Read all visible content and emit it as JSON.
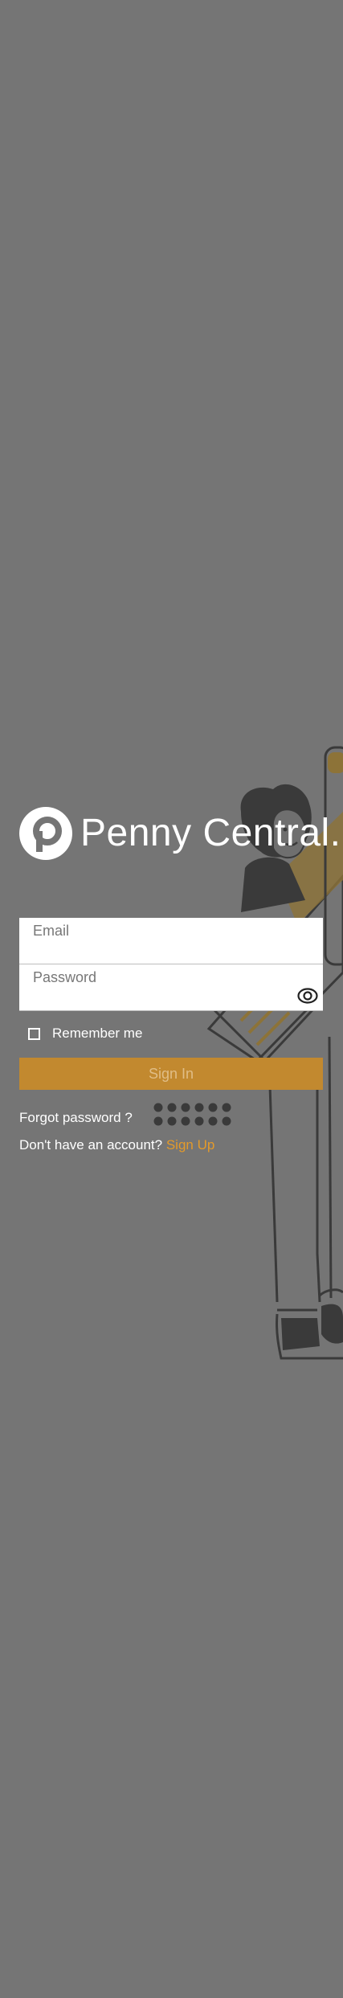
{
  "app": {
    "logo_text": "Penny Central.",
    "logo_icon": "penny-p-logo-icon"
  },
  "form": {
    "email_label": "Email",
    "email_value": "",
    "password_label": "Password",
    "password_value": "",
    "password_toggle_icon": "eye-icon",
    "remember_label": "Remember me",
    "remember_checked": false,
    "signin_label": "Sign In",
    "forgot_label": "Forgot password ?",
    "signup_prompt": "Don't have an account?",
    "signup_link": "Sign Up"
  },
  "colors": {
    "background": "#757575",
    "accent": "#c2892f",
    "link": "#e39a2a",
    "illustration_dark": "#3a3a3a",
    "illustration_gold": "#8d7338"
  }
}
